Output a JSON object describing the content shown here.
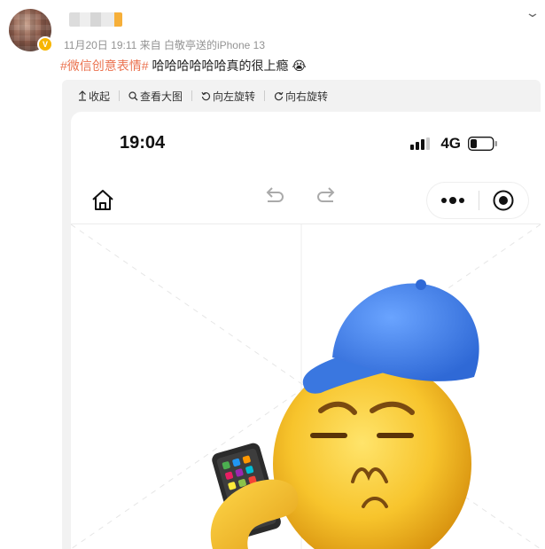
{
  "post": {
    "meta": "11月20日 19:11  来自 白敬亭送的iPhone 13",
    "topic_tag": "#微信创意表情#",
    "text": " 哈哈哈哈哈哈真的很上瘾",
    "emoji": "😭"
  },
  "toolbar": {
    "items": [
      {
        "icon": "arrow-up-icon",
        "label": "收起"
      },
      {
        "icon": "search-icon",
        "label": "查看大图"
      },
      {
        "icon": "rotate-left-icon",
        "label": "向左旋转"
      },
      {
        "icon": "rotate-right-icon",
        "label": "向右旋转"
      }
    ]
  },
  "phone": {
    "time": "19:04",
    "network": "4G"
  },
  "colors": {
    "tag": "#eb7350",
    "cap": "#3b7be0",
    "face": "#f7c42c"
  }
}
